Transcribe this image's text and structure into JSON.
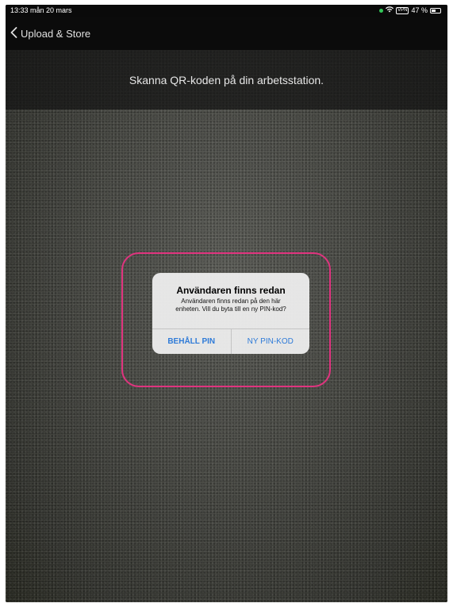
{
  "status_bar": {
    "time_date": "13:33  mån 20 mars",
    "vpn": "VPN",
    "battery": "47 %",
    "battery_level": 0.47
  },
  "nav": {
    "back_label": "Upload & Store"
  },
  "scanner": {
    "instruction": "Skanna QR-koden på din arbetsstation."
  },
  "dialog": {
    "title": "Användaren finns redan",
    "message": "Användaren finns redan på den här\nenheten. Vill du byta till en ny PIN-kod?",
    "keep_pin": "BEHÅLL PIN",
    "new_pin": "NY PIN-KOD"
  },
  "colors": {
    "highlight": "#e0347f",
    "button_text": "#2f7bd8",
    "indicator": "#34c759"
  }
}
